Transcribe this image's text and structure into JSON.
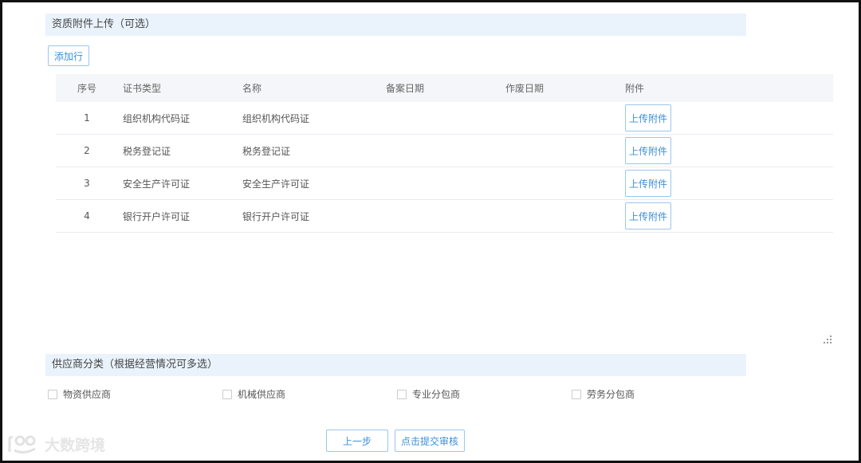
{
  "qualification": {
    "title": "资质附件上传（可选）",
    "add_row": "添加行",
    "columns": [
      "序号",
      "证书类型",
      "名称",
      "备案日期",
      "作废日期",
      "附件"
    ],
    "rows": [
      {
        "index": "1",
        "type": "组织机构代码证",
        "name": "组织机构代码证",
        "filing_date": "",
        "void_date": "",
        "upload": "上传附件"
      },
      {
        "index": "2",
        "type": "税务登记证",
        "name": "税务登记证",
        "filing_date": "",
        "void_date": "",
        "upload": "上传附件"
      },
      {
        "index": "3",
        "type": "安全生产许可证",
        "name": "安全生产许可证",
        "filing_date": "",
        "void_date": "",
        "upload": "上传附件"
      },
      {
        "index": "4",
        "type": "银行开户许可证",
        "name": "银行开户许可证",
        "filing_date": "",
        "void_date": "",
        "upload": "上传附件"
      }
    ]
  },
  "supplier_category": {
    "title": "供应商分类（根据经营情况可多选）",
    "options": [
      "物资供应商",
      "机械供应商",
      "专业分包商",
      "劳务分包商"
    ]
  },
  "footer": {
    "prev": "上一步",
    "submit": "点击提交审核"
  },
  "watermark": {
    "text": "大数跨境"
  },
  "colors": {
    "accent": "#3d8fd8",
    "section_bg": "#eaf3fc",
    "header_bg": "#f4f6f9"
  }
}
